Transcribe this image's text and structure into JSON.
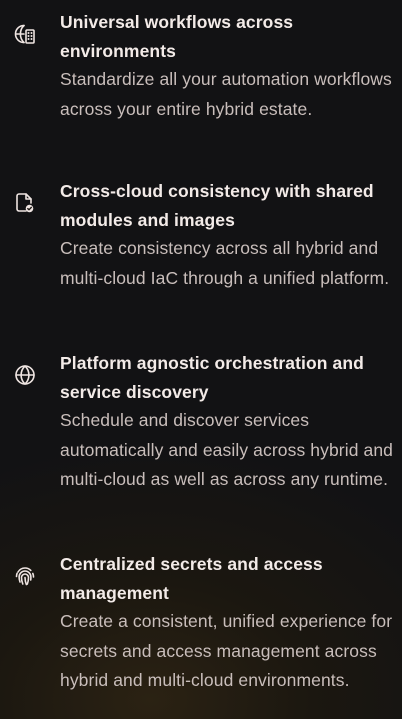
{
  "features": [
    {
      "icon": "building-globe-icon",
      "title": "Universal workflows across environments",
      "description": "Standardize all your automation workflows across your entire hybrid estate."
    },
    {
      "icon": "file-check-icon",
      "title": "Cross-cloud consistency with shared modules and images",
      "description": "Create consistency across all hybrid and multi-cloud IaC through a unified platform."
    },
    {
      "icon": "globe-icon",
      "title": "Platform agnostic orchestration and service discovery",
      "description": "Schedule and discover services automatically and easily across hybrid and multi-cloud as well as across any runtime."
    },
    {
      "icon": "fingerprint-icon",
      "title": "Centralized secrets and access management",
      "description": "Create a consistent, unified experience for secrets and access management across hybrid and multi-cloud environments."
    }
  ],
  "colors": {
    "background": "#121214",
    "title": "#f3ebe8",
    "body": "#c9bebb",
    "accent": "#d9b8a8"
  }
}
